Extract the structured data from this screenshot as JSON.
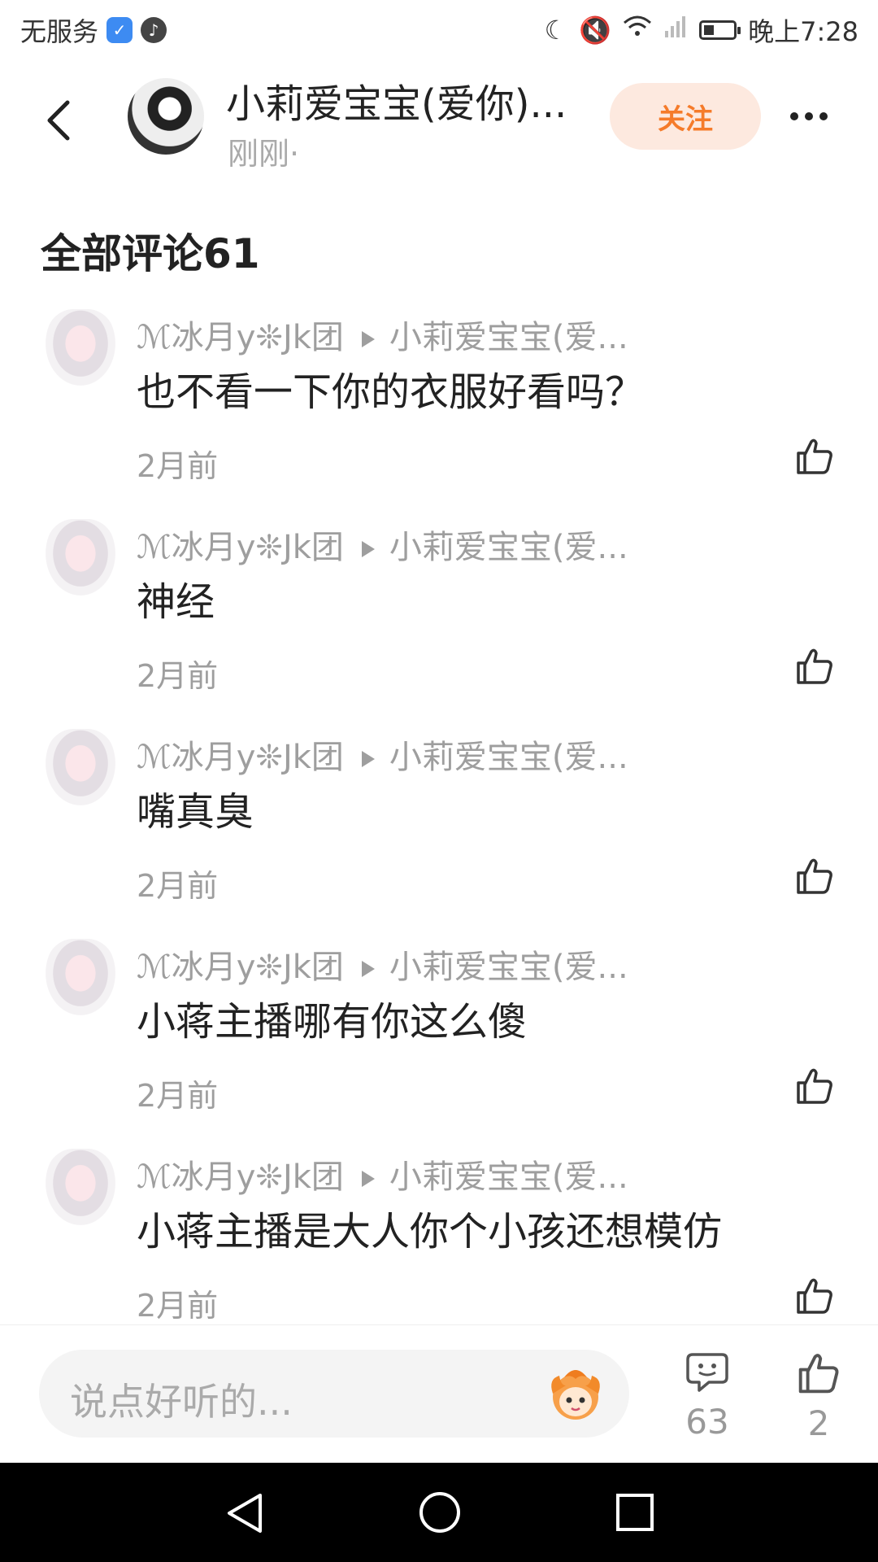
{
  "status_bar": {
    "carrier": "无服务",
    "time": "晚上7:28"
  },
  "header": {
    "title": "小莉爱宝宝(爱你)...",
    "subtitle": "刚刚·",
    "follow_label": "关注"
  },
  "comments_section": {
    "title": "全部评论61"
  },
  "comments": [
    {
      "author": "ℳ冰月y❊Jk团",
      "reply_to": "小莉爱宝宝(爱...",
      "text": "也不看一下你的衣服好看吗？",
      "time": "2月前"
    },
    {
      "author": "ℳ冰月y❊Jk团",
      "reply_to": "小莉爱宝宝(爱...",
      "text": "神经",
      "time": "2月前"
    },
    {
      "author": "ℳ冰月y❊Jk团",
      "reply_to": "小莉爱宝宝(爱...",
      "text": "嘴真臭",
      "time": "2月前"
    },
    {
      "author": "ℳ冰月y❊Jk团",
      "reply_to": "小莉爱宝宝(爱...",
      "text": "小蒋主播哪有你这么傻",
      "time": "2月前"
    },
    {
      "author": "ℳ冰月y❊Jk团",
      "reply_to": "小莉爱宝宝(爱...",
      "text": "小蒋主播是大人你个小孩还想模仿",
      "time": "2月前"
    }
  ],
  "bottom_bar": {
    "input_placeholder": "说点好听的...",
    "comment_count": "63",
    "like_count": "2"
  },
  "colors": {
    "accent": "#f57b2a",
    "follow_bg": "#fde9df",
    "meta_gray": "#9e9e9e"
  }
}
